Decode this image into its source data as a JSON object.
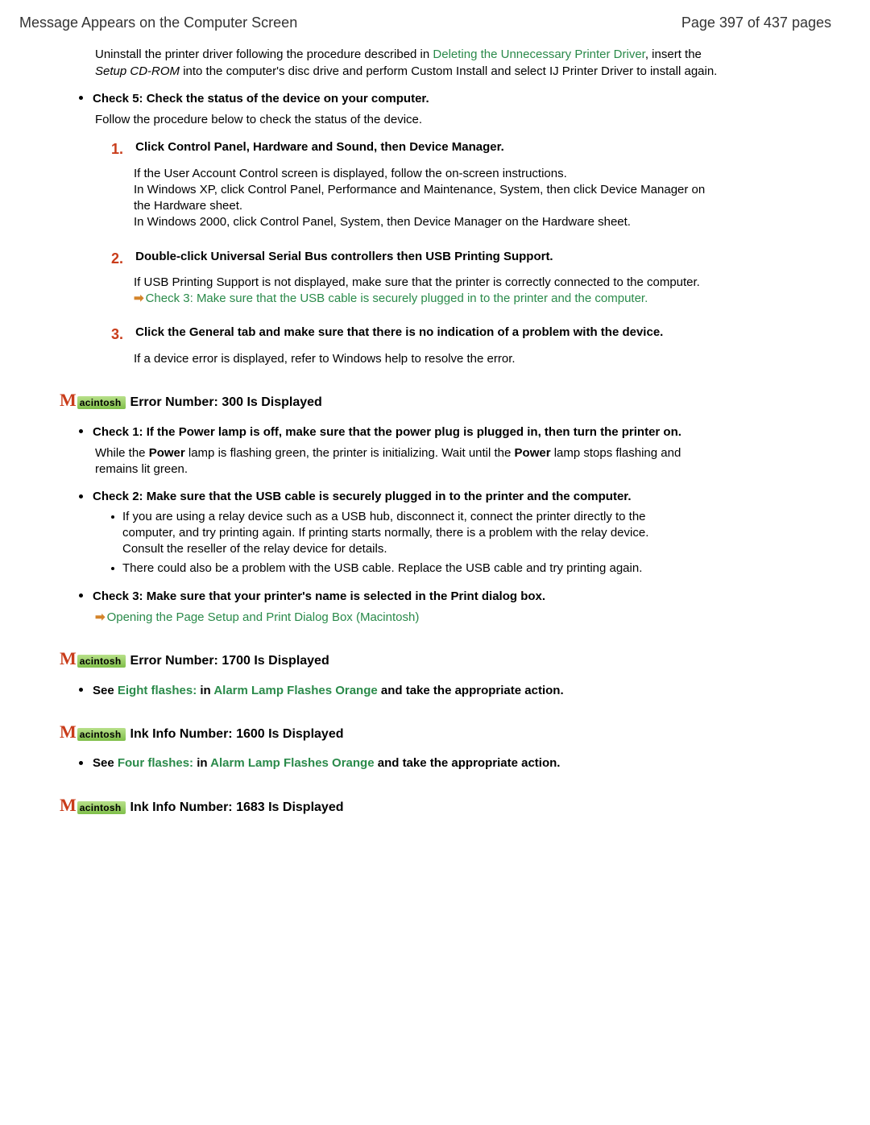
{
  "header": {
    "title": "Message Appears on the Computer Screen",
    "page": "Page 397 of 437 pages"
  },
  "intro": {
    "p1a": "Uninstall the printer driver following the procedure described in ",
    "link": "Deleting the Unnecessary Printer Driver",
    "p1b": ", insert the ",
    "ital": "Setup CD-ROM",
    "p1c": " into the computer's disc drive and perform Custom Install and select IJ Printer Driver to install again."
  },
  "check5": {
    "title": "Check 5: Check the status of the device on your computer.",
    "body": "Follow the procedure below to check the status of the device.",
    "steps": [
      {
        "num": "1.",
        "head": "Click Control Panel, Hardware and Sound, then Device Manager.",
        "body": "If the User Account Control screen is displayed, follow the on-screen instructions.\nIn Windows XP, click Control Panel, Performance and Maintenance, System, then click Device Manager on the Hardware sheet.\nIn Windows 2000, click Control Panel, System, then Device Manager on the Hardware sheet."
      },
      {
        "num": "2.",
        "head": "Double-click Universal Serial Bus controllers then USB Printing Support.",
        "body": "If USB Printing Support is not displayed, make sure that the printer is correctly connected to the computer.",
        "linktext": "Check 3: Make sure that the USB cable is securely plugged in to the printer and the computer."
      },
      {
        "num": "3.",
        "head": "Click the General tab and make sure that there is no indication of a problem with the device.",
        "body": "If a device error is displayed, refer to Windows help to resolve the error."
      }
    ]
  },
  "mac300": {
    "title": "Error Number: 300 Is Displayed",
    "c1": {
      "title": "Check 1: If the Power lamp is off, make sure that the power plug is plugged in, then turn the printer on.",
      "pa": "While the ",
      "pw1": "Power",
      "pb": " lamp is flashing green, the printer is initializing. Wait until the ",
      "pw2": "Power",
      "pc": " lamp stops flashing and remains lit green."
    },
    "c2": {
      "title": "Check 2: Make sure that the USB cable is securely plugged in to the printer and the computer.",
      "b1": "If you are using a relay device such as a USB hub, disconnect it, connect the printer directly to the computer, and try printing again. If printing starts normally, there is a problem with the relay device. Consult the reseller of the relay device for details.",
      "b2": "There could also be a problem with the USB cable. Replace the USB cable and try printing again."
    },
    "c3": {
      "title": "Check 3: Make sure that your printer's name is selected in the Print dialog box.",
      "link": "Opening the Page Setup and Print Dialog Box (Macintosh)"
    }
  },
  "mac1700": {
    "title": "Error Number: 1700 Is Displayed",
    "see": "See ",
    "l1": "Eight flashes:",
    "in": " in ",
    "l2": "Alarm Lamp Flashes Orange",
    "rest": " and take the appropriate action."
  },
  "mac1600": {
    "title": "Ink Info Number: 1600 Is Displayed",
    "see": "See ",
    "l1": "Four flashes:",
    "in": " in ",
    "l2": "Alarm Lamp Flashes Orange",
    "rest": " and take the appropriate action."
  },
  "mac1683": {
    "title": "Ink Info Number: 1683 Is Displayed"
  },
  "macbadge": "acintosh"
}
